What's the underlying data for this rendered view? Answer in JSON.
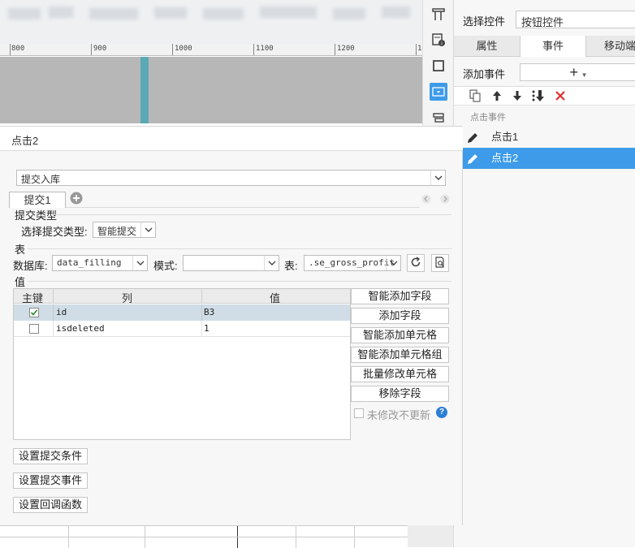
{
  "ruler": {
    "ticks": [
      "800",
      "900",
      "1000",
      "1100",
      "1200",
      "1"
    ]
  },
  "right_panel": {
    "select_control_label": "选择控件",
    "select_control_value": "按钮控件",
    "tabs": [
      "属性",
      "事件",
      "移动端"
    ],
    "add_event_label": "添加事件",
    "add_event_icon": "+",
    "section_title": "点击事件",
    "events": [
      "点击1",
      "点击2"
    ]
  },
  "dialog": {
    "title": "点击2",
    "action_select": "提交入库",
    "sub_tab": "提交1",
    "submit_type_section": "提交类型",
    "submit_type_label": "选择提交类型:",
    "submit_type_value": "智能提交",
    "table_section": "表",
    "database_label": "数据库:",
    "database_value": "data_filling",
    "schema_label": "模式:",
    "schema_value": "",
    "table_label": "表:",
    "table_value": ".se_gross_profit",
    "value_section": "值",
    "columns": [
      "主键",
      "列",
      "值"
    ],
    "rows": [
      {
        "key": true,
        "column": "id",
        "value": "B3"
      },
      {
        "key": false,
        "column": "isdeleted",
        "value": "1"
      }
    ],
    "side_buttons": [
      "智能添加字段",
      "添加字段",
      "智能添加单元格",
      "智能添加单元格组",
      "批量修改单元格",
      "移除字段"
    ],
    "unmodified_label": "未修改不更新",
    "help_icon": "?",
    "bottom_buttons": [
      "设置提交条件",
      "设置提交事件",
      "设置回调函数"
    ]
  },
  "colors": {
    "accent": "#3d9be9",
    "delete": "#e03030",
    "help": "#2a7fd4",
    "canvas_marker": "#5aa9b5"
  }
}
